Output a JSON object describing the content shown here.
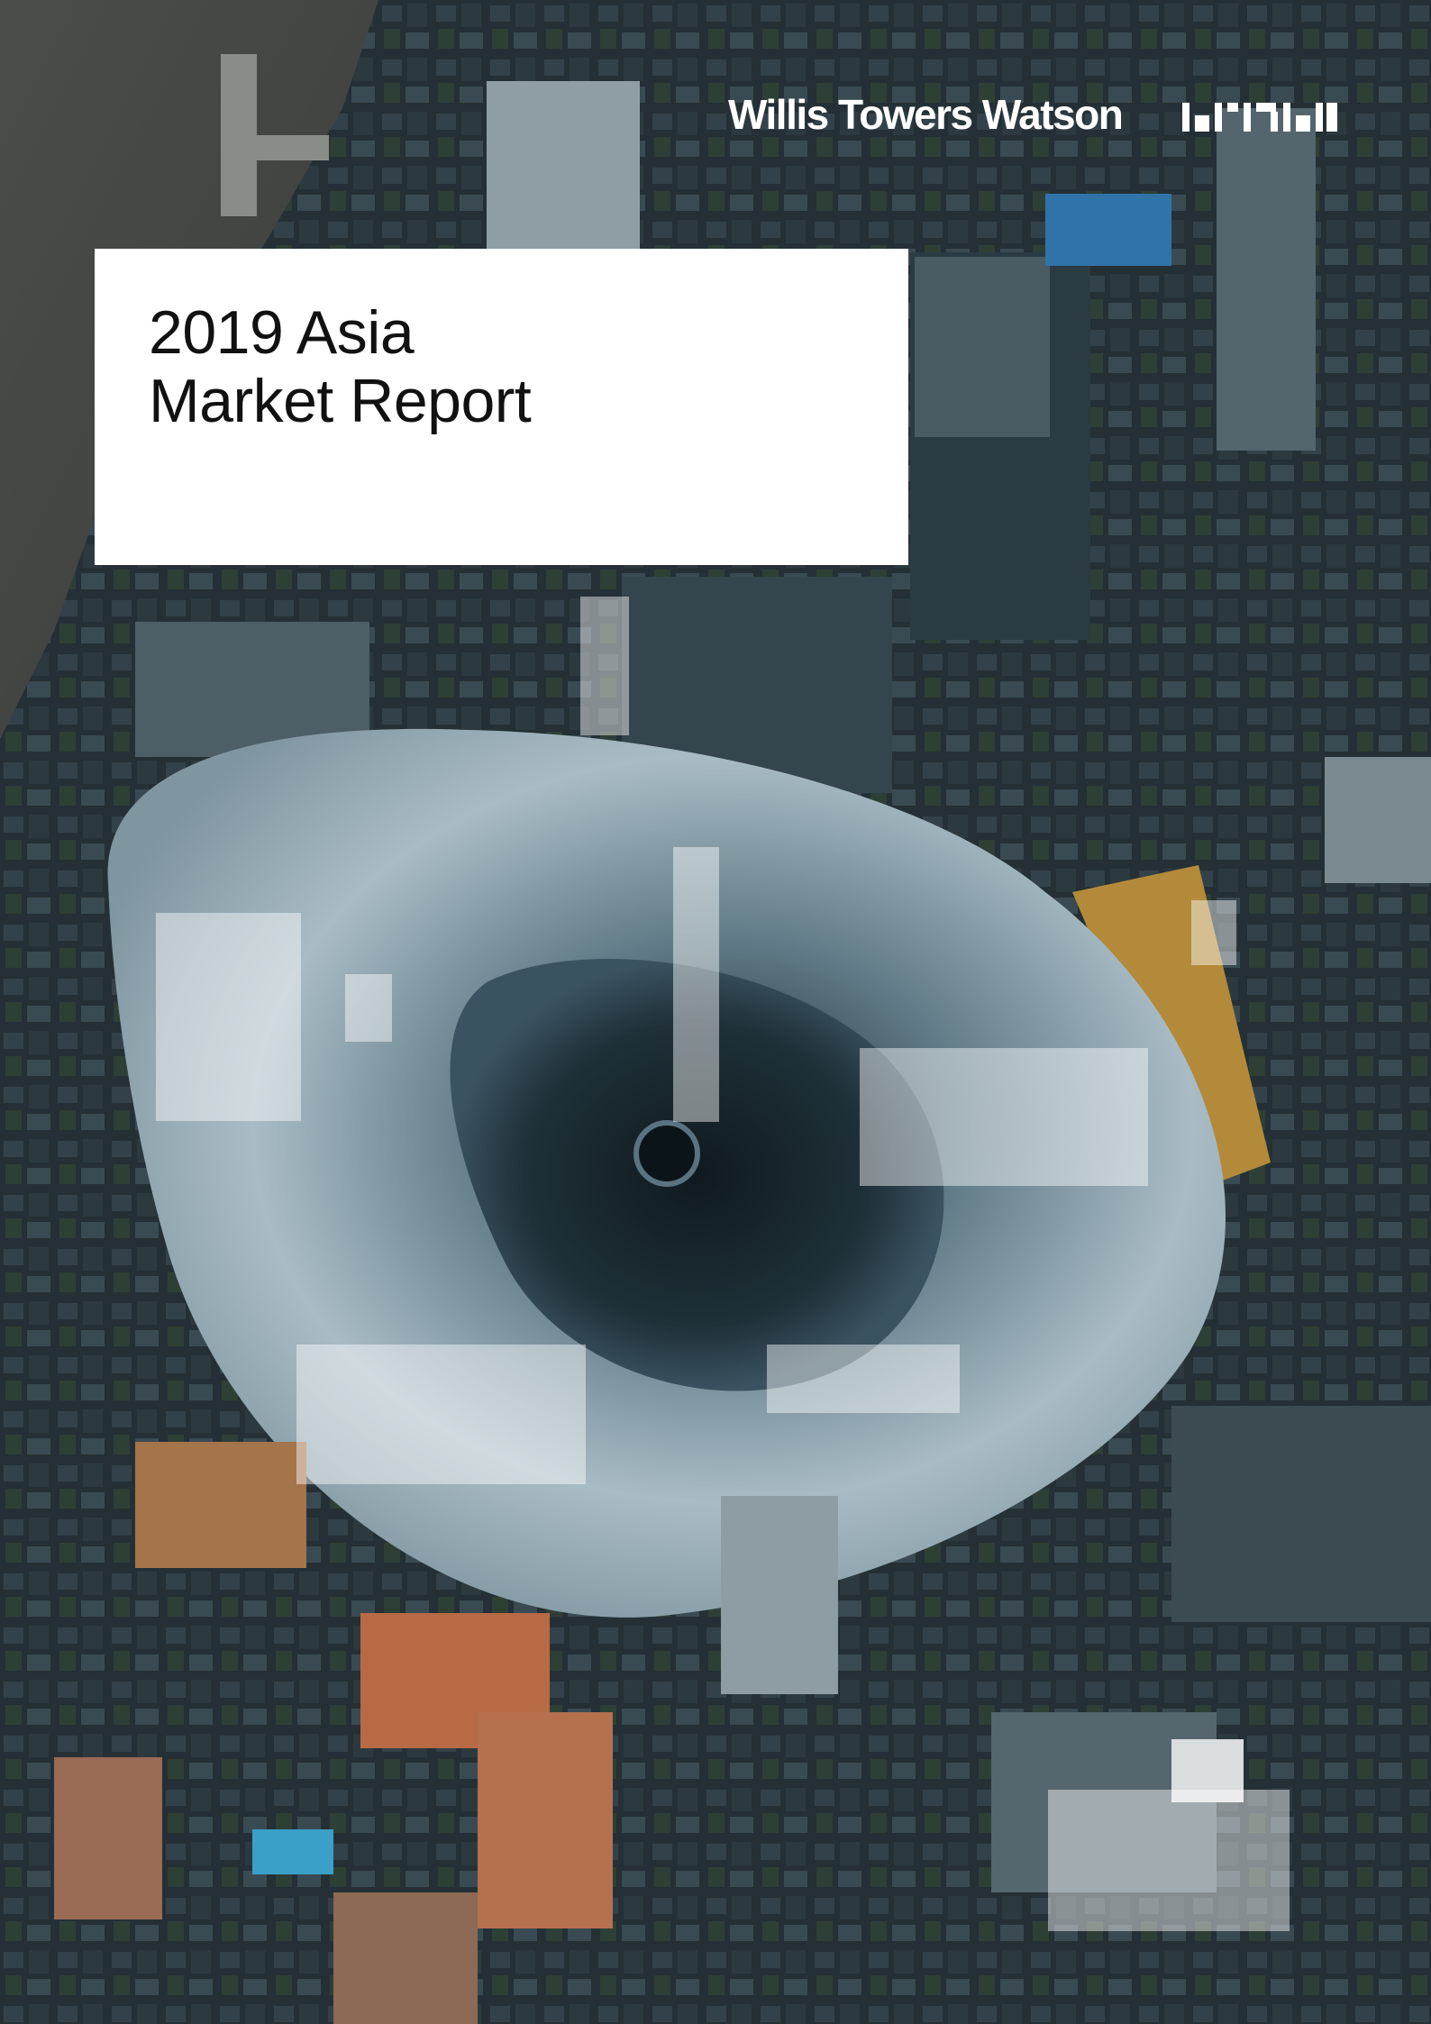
{
  "brand": {
    "name": "Willis Towers Watson",
    "logo_mark": "wtw-wordmark-icon"
  },
  "title": {
    "line1": "2019 Asia",
    "line2": "Market Report"
  },
  "colors": {
    "title_box": "#ffffff",
    "title_text": "#111111",
    "logo": "#ffffff",
    "overlay": "#ffffff"
  },
  "background": {
    "subject": "aerial-city-skyscraper-photo"
  }
}
